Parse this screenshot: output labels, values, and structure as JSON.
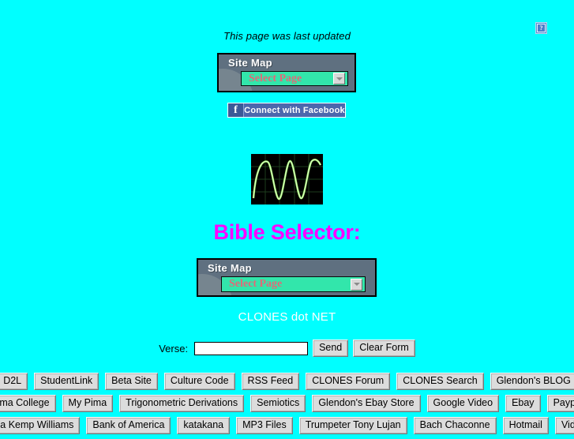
{
  "page": {
    "background_color": "#00ffff",
    "last_updated_text": "This page was last updated",
    "broken_image_glyph": "?",
    "bible_heading": "Bible Selector:",
    "bible_heading_color": "#ff00ff",
    "clones_net_text": "CLONES dot NET",
    "clones_net_color": "#ffffff"
  },
  "sitemap_top": {
    "title": "Site Map",
    "selected_option": "Select Page",
    "arrow_icon": "chevron-down-icon",
    "title_color": "#ffffff",
    "panel_color": "#5f7080",
    "select_color": "#32e6ab",
    "select_text_color": "#e06a78"
  },
  "sitemap_bottom": {
    "title": "Site Map",
    "selected_option": "Select Page",
    "arrow_icon": "chevron-down-icon",
    "title_color": "#ffffff",
    "panel_color": "#5f7080",
    "select_color": "#32e6ab",
    "select_text_color": "#e06a78"
  },
  "facebook": {
    "logo_glyph": "f",
    "label": "Connect with Facebook",
    "button_color": "#4c67ad",
    "logo_color": "#3b5998"
  },
  "scope_image": {
    "alt": "oscilloscope-sine-wave",
    "trace_color": "#9dff6a",
    "grid_color": "#1f4a1f",
    "background_color": "#000000"
  },
  "verse_form": {
    "label": "Verse:",
    "input_value": "",
    "input_placeholder": "",
    "send_label": "Send",
    "clear_label": "Clear Form"
  },
  "link_rows": [
    [
      "D2L",
      "StudentLink",
      "Beta Site",
      "Culture Code",
      "RSS Feed",
      "CLONES Forum",
      "CLONES Search",
      "Glendon's BLOG"
    ],
    [
      "Pima College",
      "My Pima",
      "Trigonometric Derivations",
      "Semiotics",
      "Glendon's Ebay Store",
      "Google Video",
      "Ebay",
      "Paypal"
    ],
    [
      "Lisa Kemp Williams",
      "Bank of America",
      "katakana",
      "MP3 Files",
      "Trumpeter Tony Lujan",
      "Bach Chaconne",
      "Hotmail",
      "Video"
    ]
  ]
}
